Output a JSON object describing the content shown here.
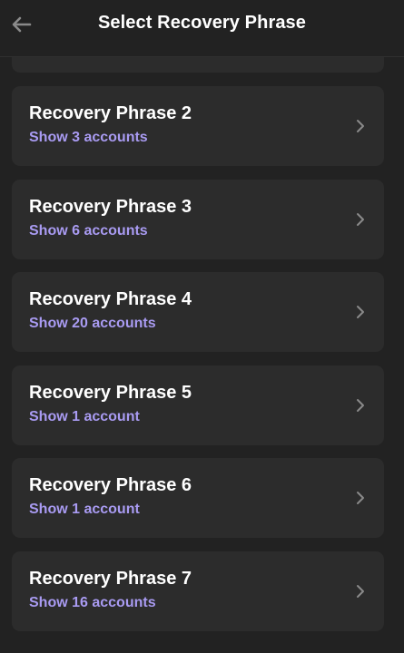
{
  "header": {
    "title": "Select Recovery Phrase",
    "back_icon": "arrow-left-icon"
  },
  "phrases": [
    {
      "name": "Recovery Phrase 2",
      "accounts_label": "Show 3 accounts"
    },
    {
      "name": "Recovery Phrase 3",
      "accounts_label": "Show 6 accounts"
    },
    {
      "name": "Recovery Phrase 4",
      "accounts_label": "Show 20 accounts"
    },
    {
      "name": "Recovery Phrase 5",
      "accounts_label": "Show 1 account"
    },
    {
      "name": "Recovery Phrase 6",
      "accounts_label": "Show 1 account"
    },
    {
      "name": "Recovery Phrase 7",
      "accounts_label": "Show 16 accounts"
    }
  ],
  "colors": {
    "background": "#222222",
    "card": "#2c2c2c",
    "accent": "#a99bf2",
    "text": "#ffffff",
    "muted_icon": "#8a8a8a"
  }
}
